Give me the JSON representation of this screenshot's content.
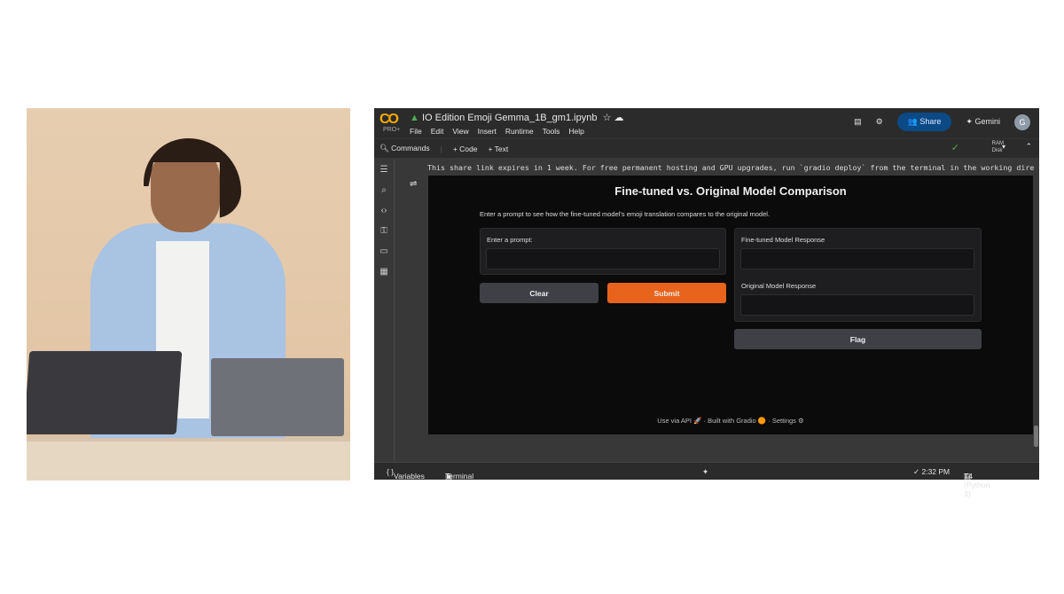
{
  "colab": {
    "logo": "CO",
    "plan": "PRO+",
    "notebook_title": "IO Edition Emoji Gemma_1B_gm1.ipynb",
    "menu": [
      "File",
      "Edit",
      "View",
      "Insert",
      "Runtime",
      "Tools",
      "Help"
    ],
    "share_label": "Share",
    "gemini_label": "Gemini",
    "avatar_initial": "G",
    "toolbar": {
      "commands": "Commands",
      "add_code": "+ Code",
      "add_text": "+ Text",
      "ram": "RAM",
      "disk": "Disk"
    },
    "output_message": "This share link expires in 1 week. For free permanent hosting and GPU upgrades, run `gradio deploy` from the terminal in the working dire",
    "status": {
      "variables": "Variables",
      "terminal": "Terminal",
      "time": "✓ 2:32 PM",
      "runtime": "T4 (Python 3)"
    }
  },
  "gradio": {
    "title": "Fine-tuned vs. Original Model Comparison",
    "description": "Enter a prompt to see how the fine-tuned model's emoji translation compares to the original model.",
    "prompt_label": "Enter a prompt:",
    "prompt_value": "",
    "finetuned_label": "Fine-tuned Model Response",
    "original_label": "Original Model Response",
    "clear_label": "Clear",
    "submit_label": "Submit",
    "flag_label": "Flag",
    "footer": {
      "api": "Use via API 🚀",
      "built": "Built with Gradio 🟠",
      "settings": "Settings ⚙"
    },
    "accent_color": "#e8641c"
  }
}
